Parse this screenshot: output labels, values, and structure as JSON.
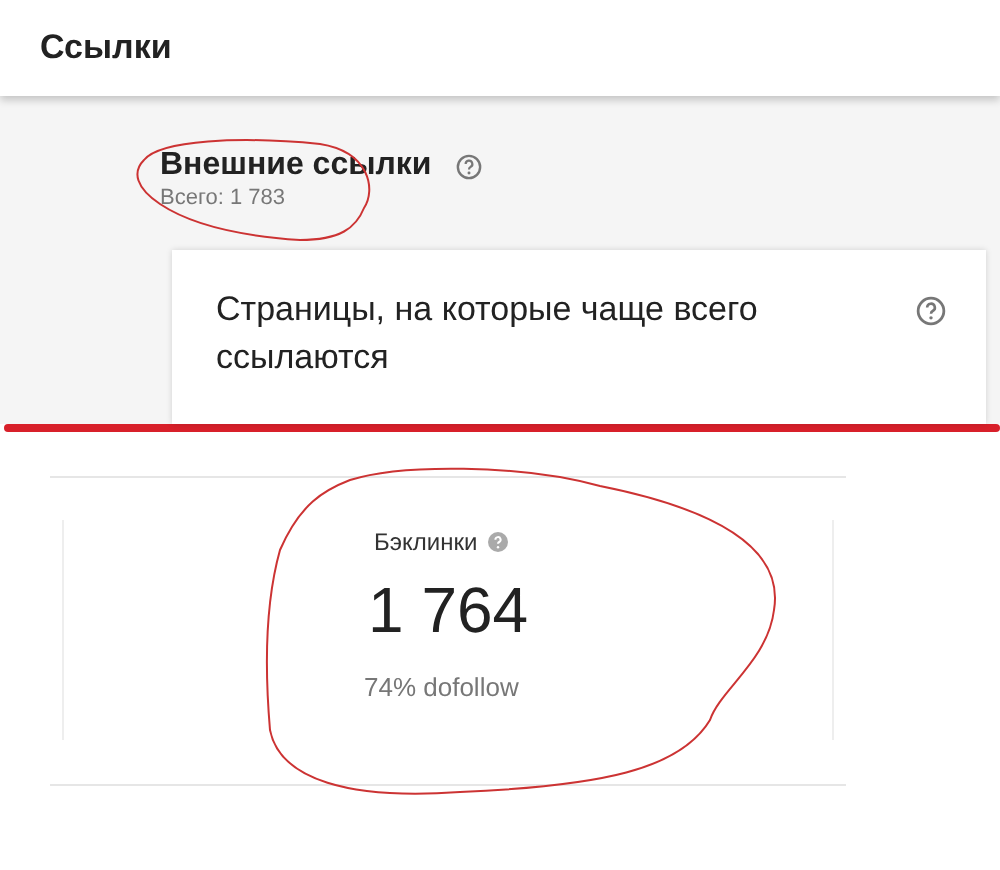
{
  "header": {
    "title": "Ссылки"
  },
  "section": {
    "title": "Внешние ссылки",
    "total": "Всего: 1 783"
  },
  "card": {
    "title": "Страницы, на которые чаще всего ссылаются"
  },
  "stat": {
    "label": "Бэклинки",
    "value": "1 764",
    "note": "74% dofollow"
  }
}
